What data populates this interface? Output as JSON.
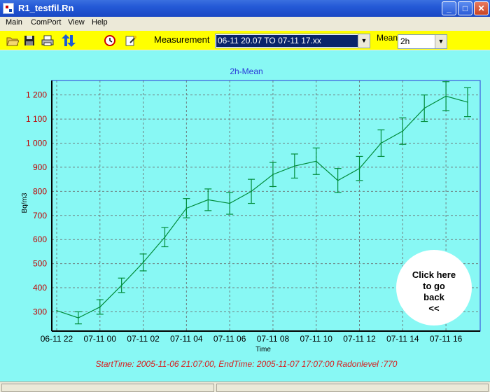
{
  "window": {
    "title": "R1_testfil.Rn"
  },
  "menu": {
    "items": [
      "Main",
      "ComPort",
      "View",
      "Help"
    ]
  },
  "toolbar": {
    "icons": [
      "open-folder-icon",
      "save-disk-icon",
      "print-icon",
      "transfer-arrows-icon",
      "clock-icon",
      "wizard-icon"
    ],
    "measurement_label": "Measurement",
    "measurement_value": "06-11 20.07 TO 07-11 17.xx",
    "mean_label": "Mean",
    "mean_value": "2h"
  },
  "go_back": {
    "lines": [
      "Click here",
      "to go",
      "back",
      "<<"
    ]
  },
  "chart_data": {
    "type": "line",
    "title": "2h-Mean",
    "xlabel": "Time",
    "ylabel": "Bq/m3",
    "grid": true,
    "ylim": [
      220,
      1260
    ],
    "y_ticks": [
      300,
      400,
      500,
      600,
      700,
      800,
      900,
      1000,
      1100,
      1200
    ],
    "y_tick_labels": [
      "300",
      "400",
      "500",
      "600",
      "700",
      "800",
      "900",
      "1 000",
      "1 100",
      "1 200"
    ],
    "x_tick_labels": [
      "06-11 22",
      "07-11 00",
      "07-11 02",
      "07-11 04",
      "07-11 06",
      "07-11 08",
      "07-11 10",
      "07-11 12",
      "07-11 14",
      "07-11 16"
    ],
    "series": [
      {
        "color": "#008c3a",
        "values": [
          305,
          275,
          320,
          410,
          505,
          610,
          730,
          765,
          750,
          800,
          870,
          905,
          925,
          845,
          895,
          1000,
          1050,
          1145,
          1195,
          1170
        ],
        "errors": [
          0,
          25,
          30,
          30,
          35,
          40,
          40,
          45,
          45,
          50,
          50,
          50,
          55,
          50,
          50,
          55,
          55,
          55,
          60,
          60
        ]
      }
    ],
    "footer": "StartTime: 2005-11-06 21:07:00, EndTime: 2005-11-07 17:07:00 Radonlevel :770"
  }
}
